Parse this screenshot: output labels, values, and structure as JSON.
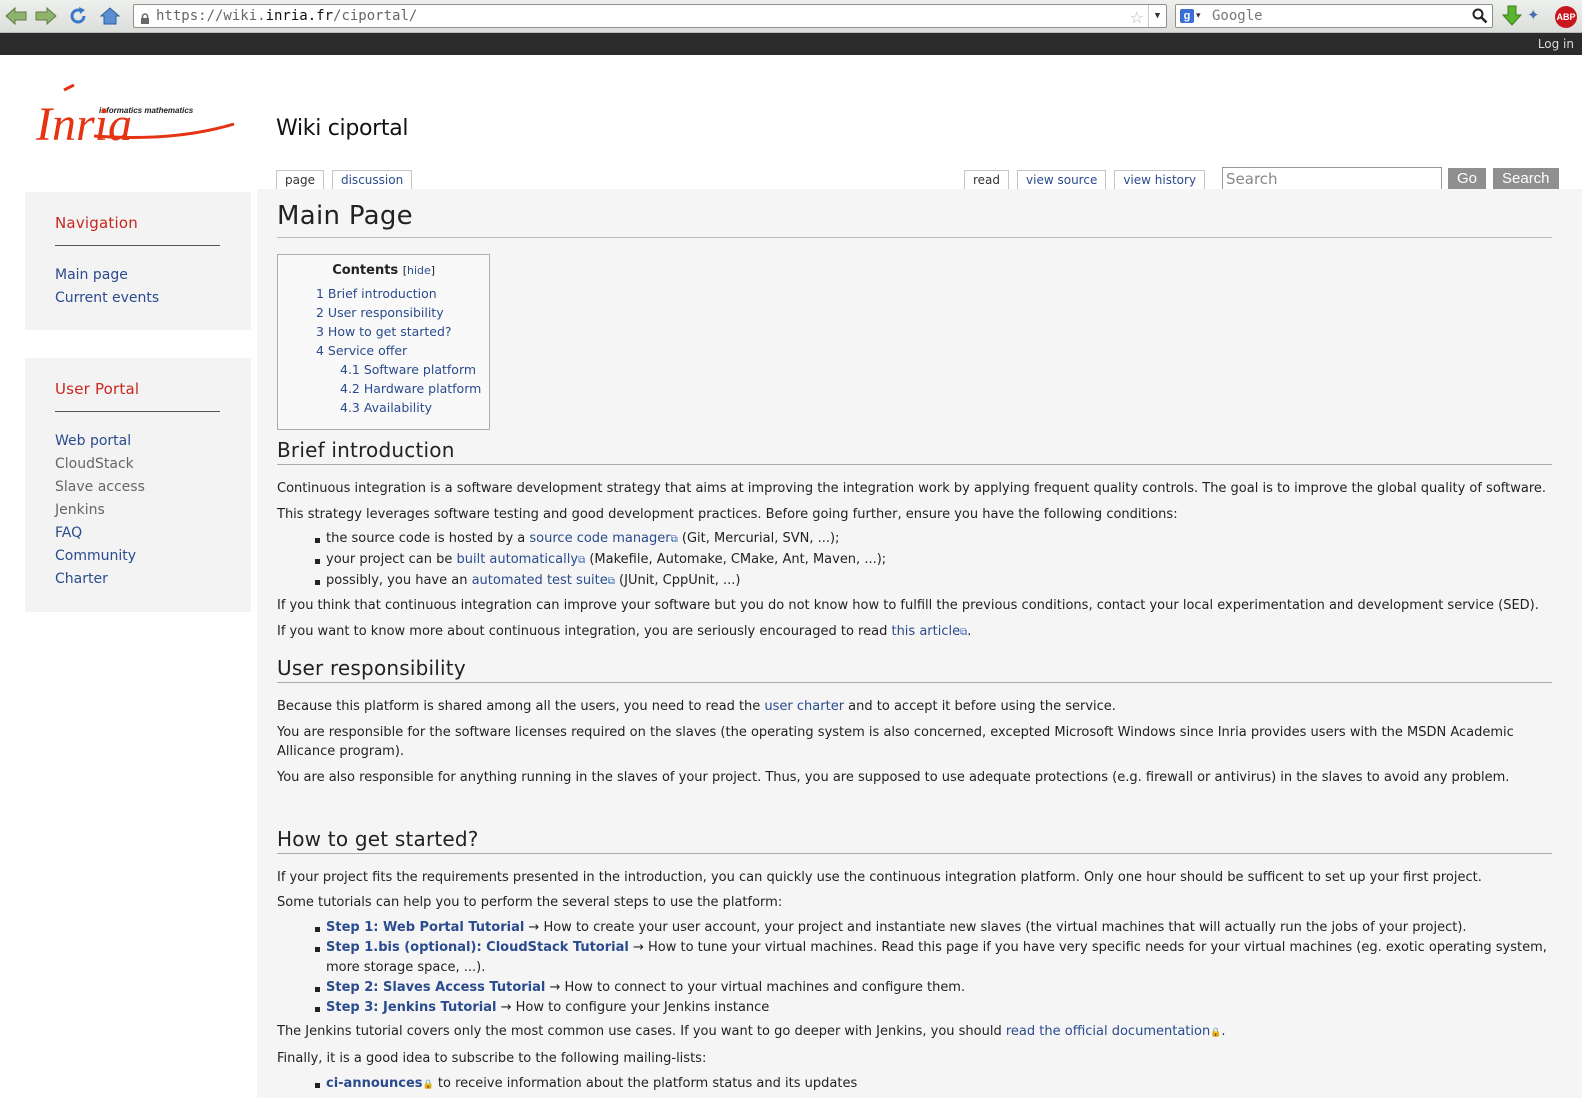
{
  "browser": {
    "url_prefix": "https://wiki.",
    "url_host": "inria.fr",
    "url_suffix": "/ciportal/",
    "search_placeholder": "Google",
    "ext_abp": "ABP"
  },
  "personal_bar": {
    "login": "Log in"
  },
  "logo": {
    "top_text": "informatics mathematics",
    "wordmark": "Inria"
  },
  "site_title": "Wiki ciportal",
  "tabs_left": [
    "page",
    "discussion"
  ],
  "tabs_right": [
    "read",
    "view source",
    "view history"
  ],
  "search": {
    "placeholder": "Search",
    "go": "Go",
    "search": "Search"
  },
  "sidebar": {
    "navigation": {
      "title": "Navigation",
      "items": [
        "Main page",
        "Current events"
      ]
    },
    "user_portal": {
      "title": "User Portal",
      "items": [
        "Web portal",
        "CloudStack",
        "Slave access",
        "Jenkins",
        "FAQ",
        "Community",
        "Charter"
      ]
    }
  },
  "page": {
    "title": "Main Page",
    "toc": {
      "title": "Contents",
      "hide": "hide",
      "items": [
        "1 Brief introduction",
        "2 User responsibility",
        "3 How to get started?",
        "4 Service offer"
      ],
      "sub": [
        "4.1 Software platform",
        "4.2 Hardware platform",
        "4.3 Availability"
      ]
    },
    "brief": {
      "heading": "Brief introduction",
      "p1": "Continuous integration is a software development strategy that aims at improving the integration work by applying frequent quality controls. The goal is to improve the global quality of software.",
      "p2": "This strategy leverages software testing and good development practices. Before going further, ensure you have the following conditions:",
      "b1_pre": "the source code is hosted by a ",
      "b1_link": "source code manager",
      "b1_post": " (Git, Mercurial, SVN, ...);",
      "b2_pre": "your project can be ",
      "b2_link": "built automatically",
      "b2_post": " (Makefile, Automake, CMake, Ant, Maven, ...);",
      "b3_pre": "possibly, you have an ",
      "b3_link": "automated test suite",
      "b3_post": " (JUnit, CppUnit, ...)",
      "p3": "If you think that continuous integration can improve your software but you do not know how to fulfill the previous conditions, contact your local experimentation and development service (SED).",
      "p4_pre": "If you want to know more about continuous integration, you are seriously encouraged to read ",
      "p4_link": "this article",
      "p4_post": "."
    },
    "responsibility": {
      "heading": "User responsibility",
      "p1_pre": "Because this platform is shared among all the users, you need to read the ",
      "p1_link": "user charter",
      "p1_post": " and to accept it before using the service.",
      "p2": "You are responsible for the software licenses required on the slaves (the operating system is also concerned, excepted Microsoft Windows since Inria provides users with the MSDN Academic Allicance program).",
      "p3": "You are also responsible for anything running in the slaves of your project. Thus, you are supposed to use adequate protections (e.g. firewall or antivirus) in the slaves to avoid any problem."
    },
    "started": {
      "heading": "How to get started?",
      "p1": "If your project fits the requirements presented in the introduction, you can quickly use the continuous integration platform. Only one hour should be sufficent to set up your first project.",
      "p2": "Some tutorials can help you to perform the several steps to use the platform:",
      "steps": [
        {
          "link": "Step 1: Web Portal Tutorial",
          "text": " → How to create your user account, your project and instantiate new slaves (the virtual machines that will actually run the jobs of your project)."
        },
        {
          "link": "Step 1.bis (optional): CloudStack Tutorial",
          "text": " → How to tune your virtual machines. Read this page if you have very specific needs for your virtual machines (eg. exotic operating system, more storage space, ...)."
        },
        {
          "link": "Step 2: Slaves Access Tutorial",
          "text": " → How to connect to your virtual machines and configure them."
        },
        {
          "link": "Step 3: Jenkins Tutorial",
          "text": " → How to configure your Jenkins instance"
        }
      ],
      "p3_pre": "The Jenkins tutorial covers only the most common use cases. If you want to go deeper with Jenkins, you should ",
      "p3_link": "read the official documentation",
      "p3_post": ".",
      "p4": "Finally, it is a good idea to subscribe to the following mailing-lists:",
      "ml_link": "ci-announces",
      "ml_text": " to receive information about the platform status and its updates"
    }
  }
}
